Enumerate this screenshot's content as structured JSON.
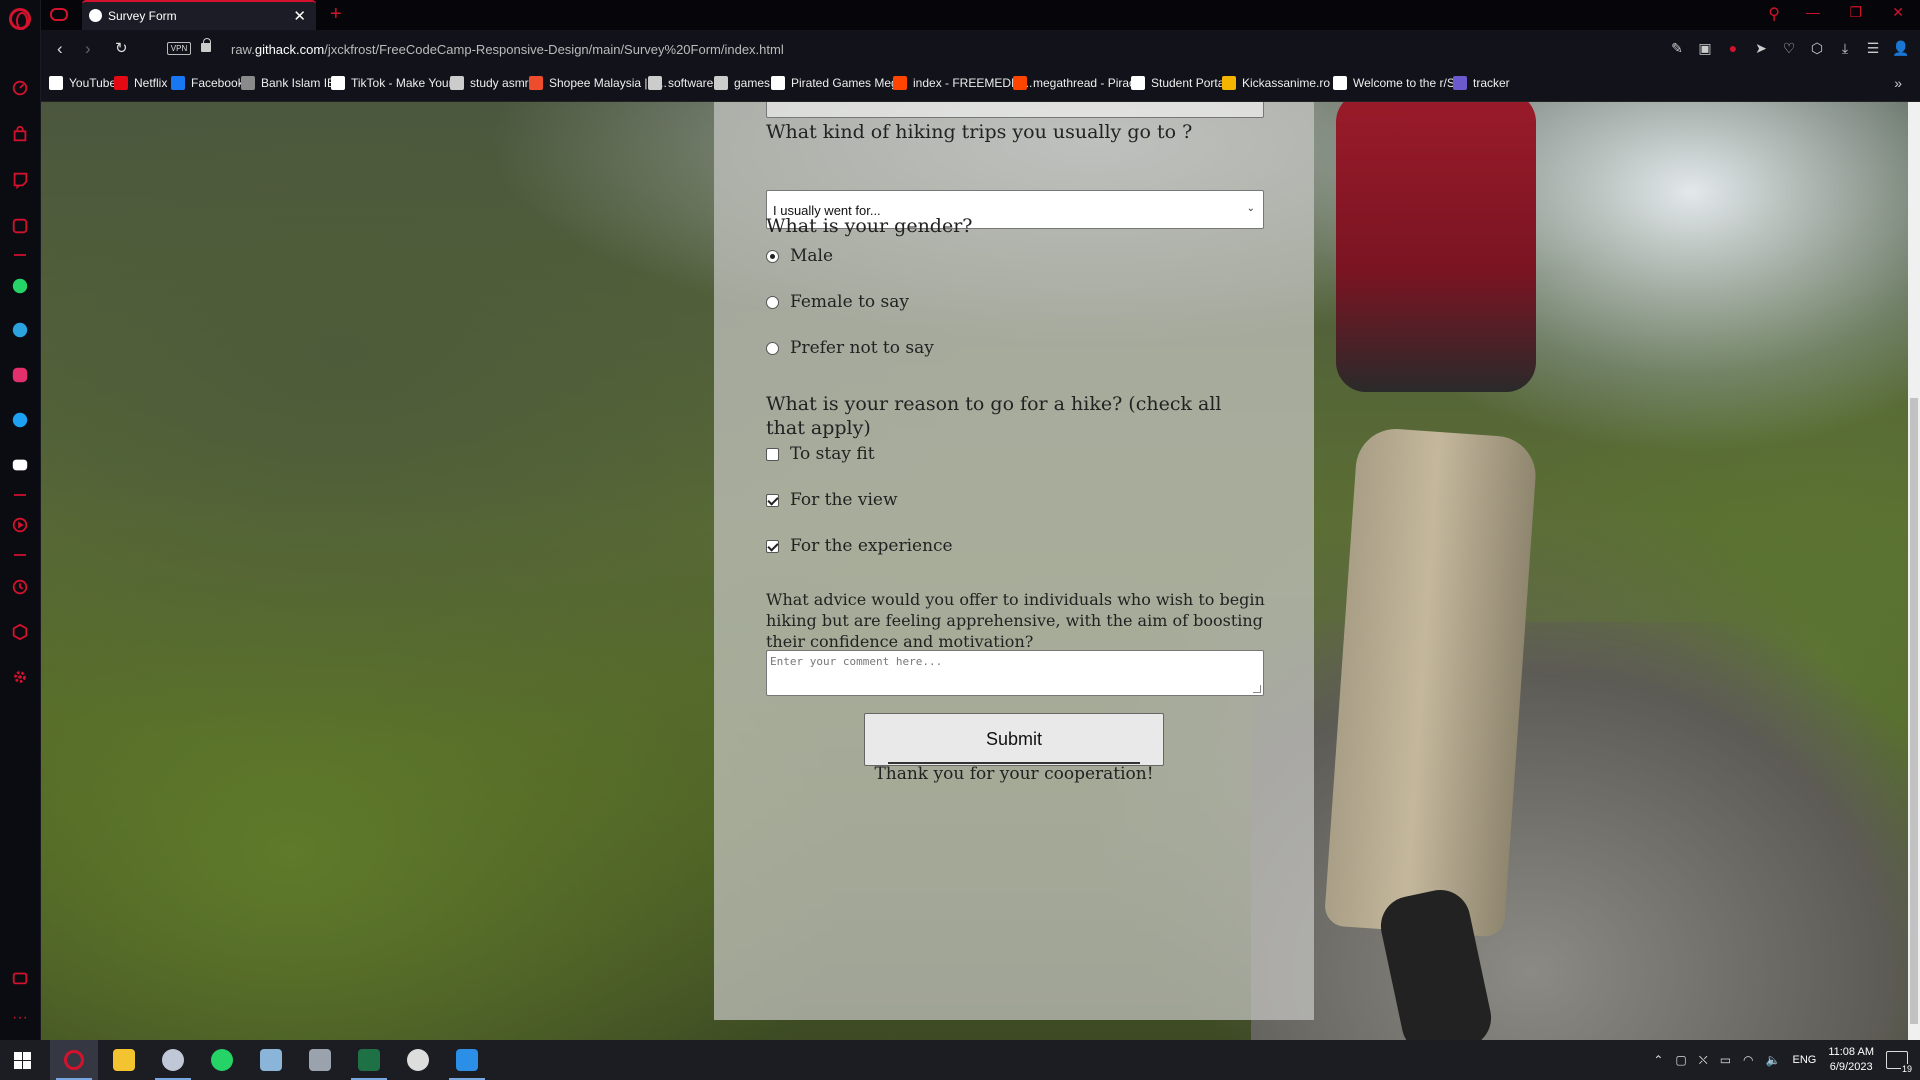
{
  "browser": {
    "tab_title": "Survey Form",
    "url_prefix": "raw.",
    "url_domain": "githack.com",
    "url_path": "/jxckfrost/FreeCodeCamp-Responsive-Design/main/Survey%20Form/index.html",
    "vpn_label": "VPN"
  },
  "bookmarks": [
    {
      "label": "YouTube",
      "color": "#ffffff"
    },
    {
      "label": "Netflix",
      "color": "#e50914"
    },
    {
      "label": "Facebook",
      "color": "#1877f2"
    },
    {
      "label": "Bank Islam IB",
      "color": "#8a8a8a"
    },
    {
      "label": "TikTok - Make Your...",
      "color": "#ffffff"
    },
    {
      "label": "study asmr",
      "color": "#cccccc"
    },
    {
      "label": "Shopee Malaysia | F...",
      "color": "#ee4d2d"
    },
    {
      "label": "software",
      "color": "#cccccc"
    },
    {
      "label": "games",
      "color": "#cccccc"
    },
    {
      "label": "Pirated Games Meg...",
      "color": "#ffffff"
    },
    {
      "label": "index - FREEMEDIA...",
      "color": "#ff4500"
    },
    {
      "label": "megathread - Piracy",
      "color": "#ff4500"
    },
    {
      "label": "Student Portal",
      "color": "#ffffff"
    },
    {
      "label": "Kickassanime.ro -...",
      "color": "#f5b400"
    },
    {
      "label": "Welcome to the r/S...",
      "color": "#ffffff"
    },
    {
      "label": "tracker",
      "color": "#6a5acd"
    }
  ],
  "form": {
    "trip_question": "What kind of hiking trips you usually go to ?",
    "trip_select_value": "I usually went for...",
    "gender_question": "What is your gender?",
    "gender_options": [
      "Male",
      "Female to say",
      "Prefer not to say"
    ],
    "gender_selected": "Male",
    "reason_question": "What is your reason to go for a hike? (check all that apply)",
    "reason_options": [
      "To stay fit",
      "For the view",
      "For the experience"
    ],
    "reason_checked": [
      false,
      true,
      true
    ],
    "advice_question": "What advice would you offer to individuals who wish to begin hiking but are feeling apprehensive, with the aim of boosting their confidence and motivation?",
    "comment_placeholder": "Enter your comment here...",
    "submit_label": "Submit",
    "thanks": "Thank you for your cooperation!"
  },
  "taskbar": {
    "language": "ENG",
    "time": "11:08 AM",
    "date": "6/9/2023",
    "notifications": "19"
  }
}
